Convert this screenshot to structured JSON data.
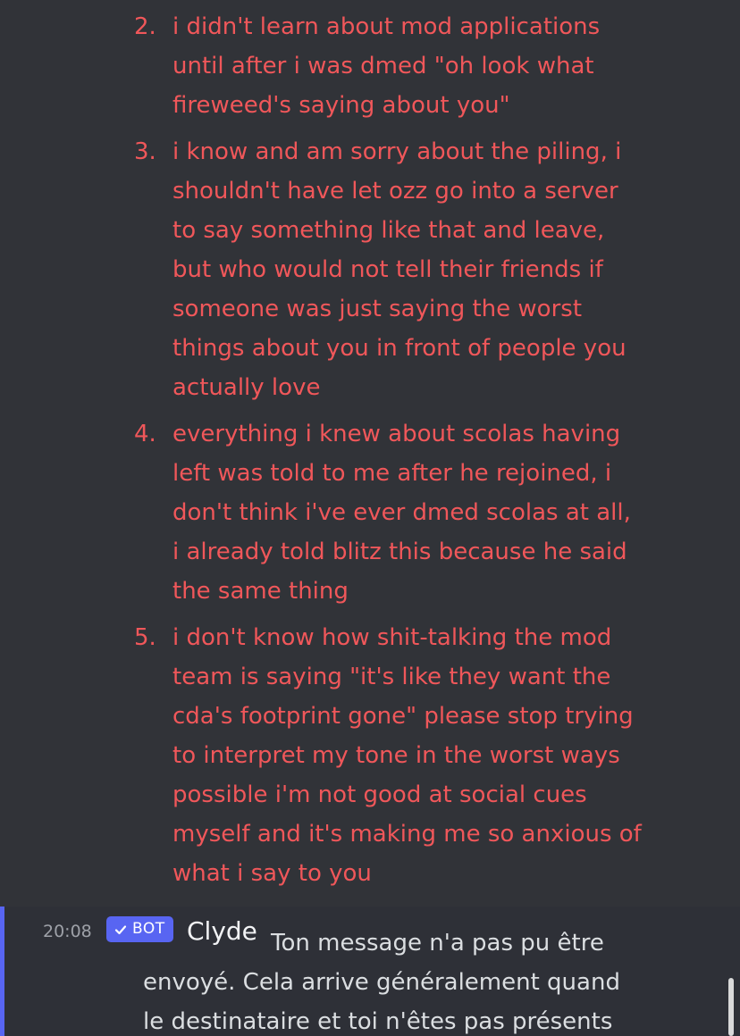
{
  "failed_message": {
    "items": [
      {
        "number": "2.",
        "text": "i didn't learn about mod applications\nuntil after i was dmed \"oh look what\nfireweed's saying about you\""
      },
      {
        "number": "3.",
        "text": "i know and am sorry about the piling, i\nshouldn't have let ozz go into a server\nto say something like that and leave,\nbut who would not tell their friends if\nsomeone was just saying the worst\nthings about you in front of people you\nactually love"
      },
      {
        "number": "4.",
        "text": "everything i knew about scolas having\nleft was told to me after he rejoined, i\ndon't think i've ever dmed scolas at all,\ni already told blitz this because he said\nthe same thing"
      },
      {
        "number": "5.",
        "text": "i don't know how shit-talking the mod\nteam is saying \"it's like they want the\ncda's footprint gone\" please stop trying\nto interpret my tone in the worst ways\npossible i'm not good at social cues\nmyself and it's making me so anxious of\nwhat i say to you"
      }
    ]
  },
  "bot_message": {
    "timestamp": "20:08",
    "badge_label": "BOT",
    "badge_icon": "checkmark-icon",
    "author": "Clyde",
    "text_first_line": "Ton message n'a pas pu être",
    "text_rest": "envoyé. Cela arrive généralement quand\nle destinataire et toi n'êtes pas présents"
  },
  "colors": {
    "background": "#313338",
    "failed_text": "#f0575a",
    "accent": "#5865f2",
    "timestamp": "#9ea1a8",
    "message_text": "#dbdee1"
  }
}
